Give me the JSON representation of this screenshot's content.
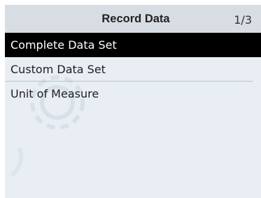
{
  "header": {
    "title": "Record Data",
    "page_indicator": "1/3"
  },
  "menu": {
    "items": [
      {
        "label": "Complete Data Set",
        "selected": true
      },
      {
        "label": "Custom Data Set",
        "selected": false
      },
      {
        "label": "Unit of Measure",
        "selected": false
      }
    ]
  },
  "colors": {
    "screen_background": "#e8eef3",
    "header_background": "#d7dde2",
    "selected_background": "#000000",
    "selected_text": "#ffffff"
  },
  "icons": {
    "watermark": "gear-watermark-icon"
  }
}
